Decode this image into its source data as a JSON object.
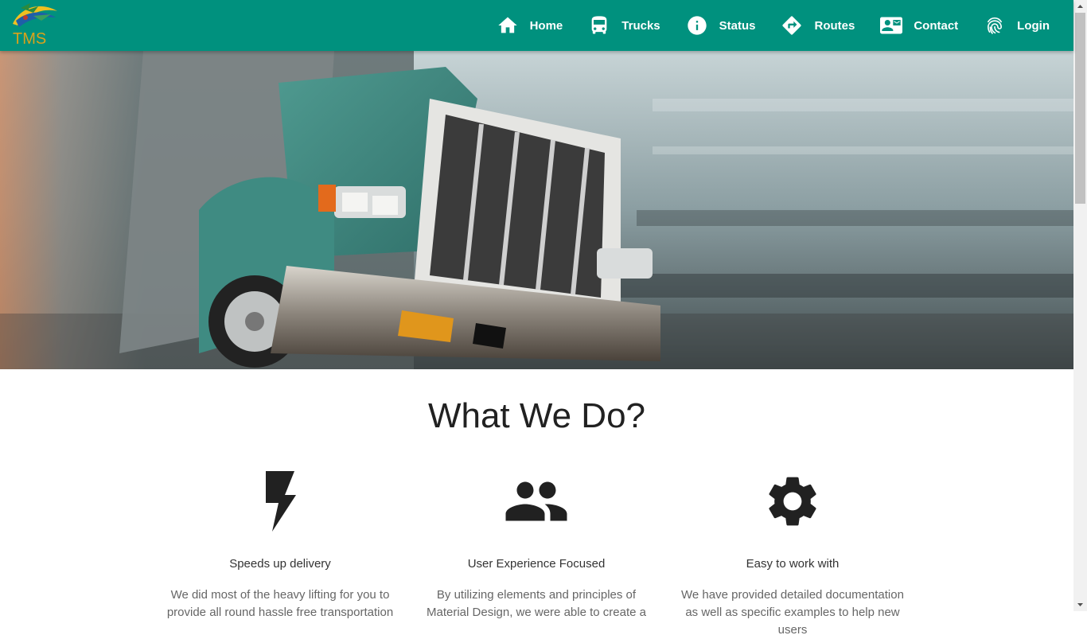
{
  "brand": {
    "logo_text": "TMS"
  },
  "nav": {
    "items": [
      {
        "label": "Home",
        "icon": "home-icon"
      },
      {
        "label": "Trucks",
        "icon": "bus-icon"
      },
      {
        "label": "Status",
        "icon": "info-icon"
      },
      {
        "label": "Routes",
        "icon": "directions-icon"
      },
      {
        "label": "Contact",
        "icon": "contact-mail-icon"
      },
      {
        "label": "Login",
        "icon": "fingerprint-icon"
      }
    ]
  },
  "hero": {
    "image": "truck-hero-image"
  },
  "section": {
    "title": "What We Do?",
    "features": [
      {
        "icon": "flash-icon",
        "title": "Speeds up delivery",
        "text": "We did most of the heavy lifting for you to provide all round hassle free transportation"
      },
      {
        "icon": "group-icon",
        "title": "User Experience Focused",
        "text": "By utilizing elements and principles of Material Design, we were able to create a"
      },
      {
        "icon": "settings-icon",
        "title": "Easy to work with",
        "text": "We have provided detailed documentation as well as specific examples to help new users"
      }
    ]
  },
  "colors": {
    "nav_bg": "#00917e",
    "text": "#212121",
    "muted": "#666666"
  }
}
